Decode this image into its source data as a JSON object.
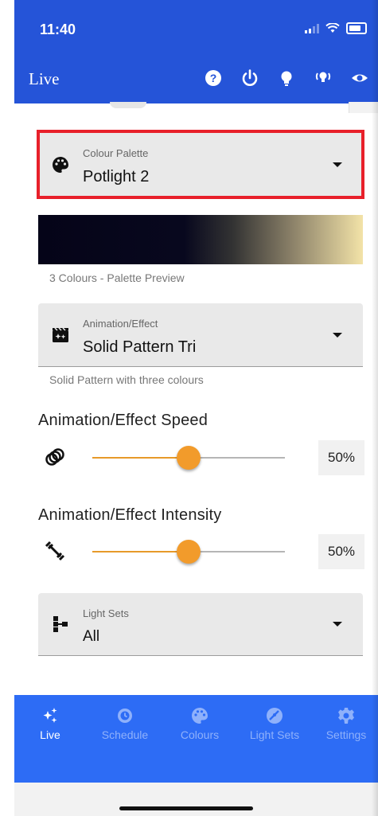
{
  "status": {
    "time": "11:40"
  },
  "header": {
    "title": "Live"
  },
  "header_icons": [
    "help-icon",
    "power-icon",
    "bulb-icon",
    "broadcast-icon",
    "eye-icon"
  ],
  "palette_select": {
    "label": "Colour Palette",
    "value": "Potlight 2"
  },
  "palette_preview": {
    "caption": "3 Colours - Palette Preview",
    "colors": [
      "#050418",
      "#8a8068",
      "#f3e3a8"
    ]
  },
  "effect_select": {
    "label": "Animation/Effect",
    "value": "Solid Pattern Tri",
    "helper": "Solid Pattern with three colours"
  },
  "speed": {
    "title": "Animation/Effect Speed",
    "value_text": "50%",
    "value": 0.5
  },
  "intensity": {
    "title": "Animation/Effect Intensity",
    "value_text": "50%",
    "value": 0.5
  },
  "lightsets_select": {
    "label": "Light Sets",
    "value": "All"
  },
  "nav": {
    "items": [
      {
        "label": "Live",
        "icon": "sparkles-icon",
        "active": true
      },
      {
        "label": "Schedule",
        "icon": "schedule-icon",
        "active": false
      },
      {
        "label": "Colours",
        "icon": "palette-icon",
        "active": false
      },
      {
        "label": "Light Sets",
        "icon": "light-sets-icon",
        "active": false
      },
      {
        "label": "Settings",
        "icon": "gear-icon",
        "active": false
      }
    ]
  },
  "colors": {
    "primary": "#2554d8",
    "nav": "#2d6cf5",
    "accent": "#f29b2b",
    "highlight": "#e8202a"
  }
}
